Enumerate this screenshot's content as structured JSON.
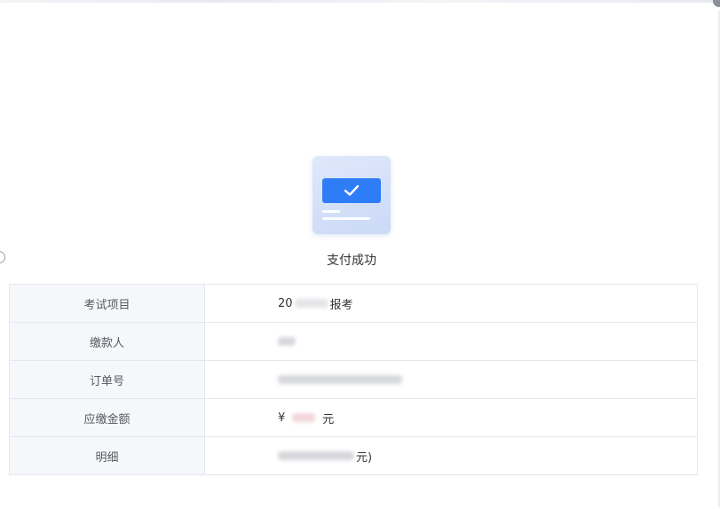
{
  "status": {
    "message": "支付成功"
  },
  "table": {
    "rows": [
      {
        "label": "考试项目",
        "value_prefix": "20",
        "value_suffix": "报考"
      },
      {
        "label": "缴款人"
      },
      {
        "label": "订单号"
      },
      {
        "label": "应缴金额",
        "value_prefix": "¥",
        "value_suffix": "元"
      },
      {
        "label": "明细",
        "value_suffix": "元)"
      }
    ]
  },
  "colors": {
    "accent": "#2f7df6",
    "icon_bg": "#dfe8fb",
    "label_bg": "#f5f7fa",
    "border": "#e4e7ed"
  },
  "icons": {
    "success": "payment-success-check-card-icon"
  }
}
